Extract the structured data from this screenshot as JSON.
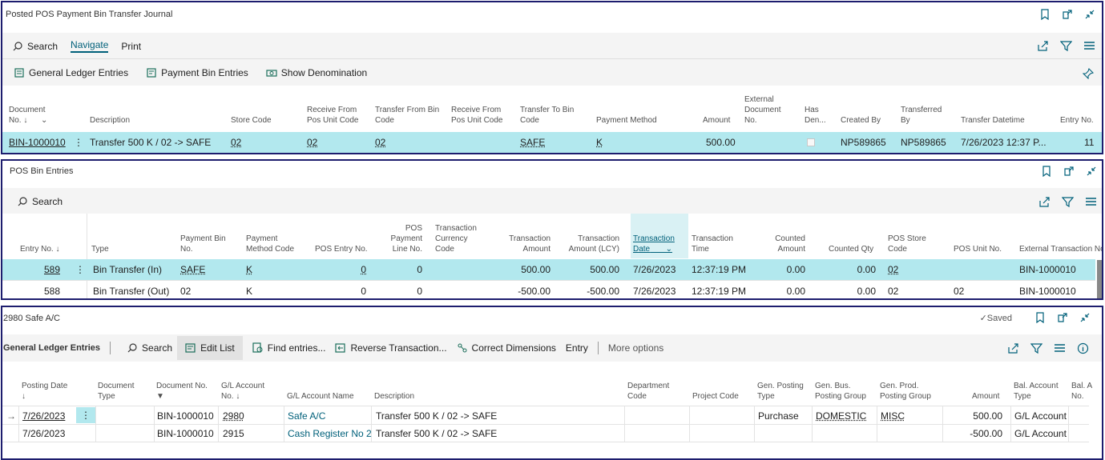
{
  "p1": {
    "title": "Posted POS Payment Bin Transfer Journal",
    "tabs": {
      "search": "Search",
      "navigate": "Navigate",
      "print": "Print"
    },
    "actions": {
      "gle": "General Ledger Entries",
      "pbe": "Payment Bin Entries",
      "denom": "Show Denomination"
    },
    "headers": {
      "doc_no": [
        "Document",
        "No. ↓"
      ],
      "description": "Description",
      "store_code": "Store Code",
      "receive_from": [
        "Receive From",
        "Pos Unit Code"
      ],
      "transfer_from_bin": [
        "Transfer From Bin",
        "Code"
      ],
      "receive_from2": [
        "Receive From",
        "Pos Unit Code"
      ],
      "transfer_to_bin": [
        "Transfer To Bin",
        "Code"
      ],
      "payment_method": "Payment Method",
      "amount": "Amount",
      "ext_doc": [
        "External",
        "Document",
        "No."
      ],
      "has_den": [
        "Has",
        "Den..."
      ],
      "created_by": "Created By",
      "transferred_by": [
        "Transferred",
        "By"
      ],
      "transfer_dt": "Transfer Datetime",
      "entry_no": "Entry No."
    },
    "row": {
      "doc_no": "BIN-1000010",
      "description": "Transfer 500 K / 02 -> SAFE",
      "store_code": "02",
      "receive_from": "02",
      "transfer_from_bin": "02",
      "transfer_to_bin": "SAFE",
      "payment_method": "K",
      "amount": "500.00",
      "created_by": "NP589865",
      "transferred_by": "NP589865",
      "transfer_dt": "7/26/2023 12:37 P...",
      "entry_no": "11"
    }
  },
  "p2": {
    "title": "POS Bin Entries",
    "search": "Search",
    "headers": {
      "entry_no": "Entry No. ↓",
      "type": "Type",
      "payment_bin": [
        "Payment Bin",
        "No."
      ],
      "pm_code": [
        "Payment",
        "Method Code"
      ],
      "pos_entry": "POS Entry No.",
      "pos_pay_line": [
        "POS",
        "Payment",
        "Line No."
      ],
      "tcc": [
        "Transaction",
        "Currency",
        "Code"
      ],
      "t_amount": [
        "Transaction",
        "Amount"
      ],
      "t_amount_lcy": [
        "Transaction",
        "Amount (LCY)"
      ],
      "t_date": [
        "Transaction",
        "Date"
      ],
      "t_time": [
        "Transaction",
        "Time"
      ],
      "counted_amount": [
        "Counted",
        "Amount"
      ],
      "counted_qty": "Counted Qty",
      "pos_store": [
        "POS Store",
        "Code"
      ],
      "pos_unit": "POS Unit No.",
      "ext_trans": "External Transaction No."
    },
    "rows": [
      {
        "entry_no": "589",
        "type": "Bin Transfer (In)",
        "payment_bin": "SAFE",
        "pm_code": "K",
        "pos_entry": "0",
        "pos_pay_line": "0",
        "t_amount": "500.00",
        "t_amount_lcy": "500.00",
        "t_date": "7/26/2023",
        "t_time": "12:37:19 PM",
        "counted_amount": "0.00",
        "counted_qty": "0.00",
        "pos_store": "02",
        "pos_unit": "",
        "ext_trans": "BIN-1000010"
      },
      {
        "entry_no": "588",
        "type": "Bin Transfer (Out)",
        "payment_bin": "02",
        "pm_code": "K",
        "pos_entry": "0",
        "pos_pay_line": "0",
        "t_amount": "-500.00",
        "t_amount_lcy": "-500.00",
        "t_date": "7/26/2023",
        "t_time": "12:37:19 PM",
        "counted_amount": "0.00",
        "counted_qty": "0.00",
        "pos_store": "02",
        "pos_unit": "02",
        "ext_trans": "BIN-1000010"
      }
    ]
  },
  "p3": {
    "title": "2980 Safe A/C",
    "saved": "Saved",
    "section": "General Ledger Entries",
    "actions": {
      "search": "Search",
      "edit": "Edit List",
      "find": "Find entries...",
      "reverse": "Reverse Transaction...",
      "correct": "Correct Dimensions",
      "entry": "Entry",
      "more": "More options"
    },
    "headers": {
      "posting_date": [
        "Posting Date",
        "↓"
      ],
      "doc_type": [
        "Document",
        "Type"
      ],
      "doc_no": "Document No.",
      "gl_acc": [
        "G/L Account",
        "No. ↓"
      ],
      "gl_name": "G/L Account Name",
      "description": "Description",
      "dept": [
        "Department",
        "Code"
      ],
      "project": "Project Code",
      "gen_post": [
        "Gen. Posting",
        "Type"
      ],
      "gen_bus": [
        "Gen. Bus.",
        "Posting Group"
      ],
      "gen_prod": [
        "Gen. Prod.",
        "Posting Group"
      ],
      "amount": "Amount",
      "bal_type": [
        "Bal. Account",
        "Type"
      ],
      "bal_no": [
        "Bal. A",
        "No."
      ]
    },
    "rows": [
      {
        "posting_date": "7/26/2023",
        "doc_no": "BIN-1000010",
        "gl_acc": "2980",
        "gl_name": "Safe A/C",
        "description": "Transfer 500 K / 02 -> SAFE",
        "gen_post": "Purchase",
        "gen_bus": "DOMESTIC",
        "gen_prod": "MISC",
        "amount": "500.00",
        "bal_type": "G/L Account"
      },
      {
        "posting_date": "7/26/2023",
        "doc_no": "BIN-1000010",
        "gl_acc": "2915",
        "gl_name": "Cash Register No 2",
        "description": "Transfer 500 K / 02 -> SAFE",
        "gen_post": "",
        "gen_bus": "",
        "gen_prod": "",
        "amount": "-500.00",
        "bal_type": "G/L Account"
      }
    ]
  }
}
